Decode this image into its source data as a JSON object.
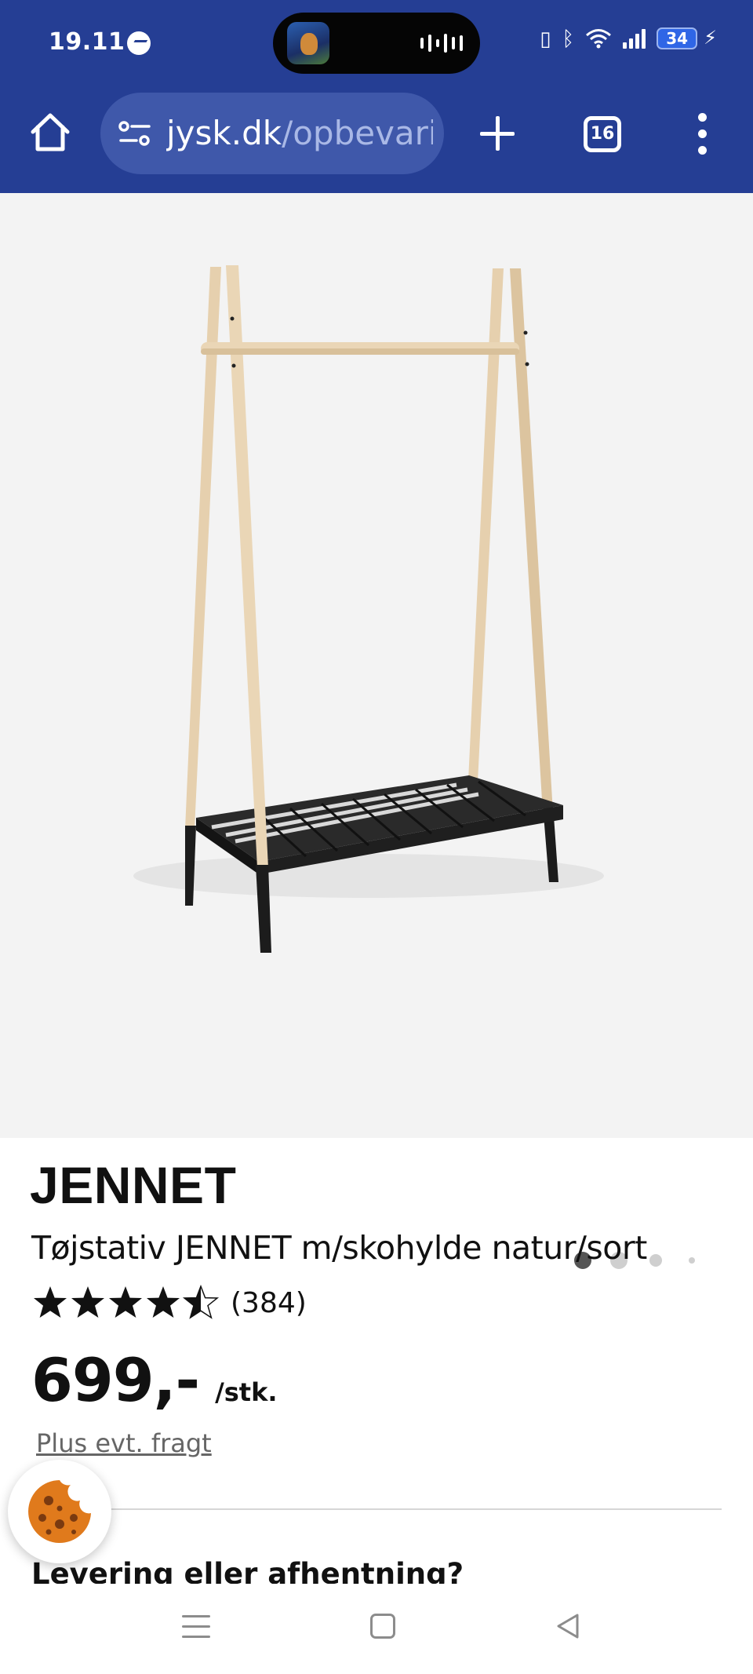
{
  "status_bar": {
    "time": "19.11",
    "battery": "34"
  },
  "browser": {
    "url_domain": "jysk.dk",
    "url_path": "/opbevari",
    "tab_count": "16"
  },
  "gallery": {
    "image_name": "clothes-rack-product-image",
    "page_count": 4,
    "active_index": 0
  },
  "product": {
    "brand": "JENNET",
    "subtitle": "Tøjstativ JENNET m/skohylde natur/sort",
    "rating_value": 4.5,
    "rating_max": 5,
    "rating_count": "(384)",
    "price": "699,-",
    "unit": "/stk.",
    "shipping_link": "Plus evt. fragt"
  },
  "delivery": {
    "heading": "Levering eller afhentning?"
  },
  "cookie": {
    "icon": "cookie-icon"
  },
  "colors": {
    "chrome_bg": "#253e94",
    "urlbar_bg": "#3f58aa",
    "gallery_bg": "#f3f3f3",
    "wood": "#e8d2b0",
    "black": "#1e1e1e"
  }
}
